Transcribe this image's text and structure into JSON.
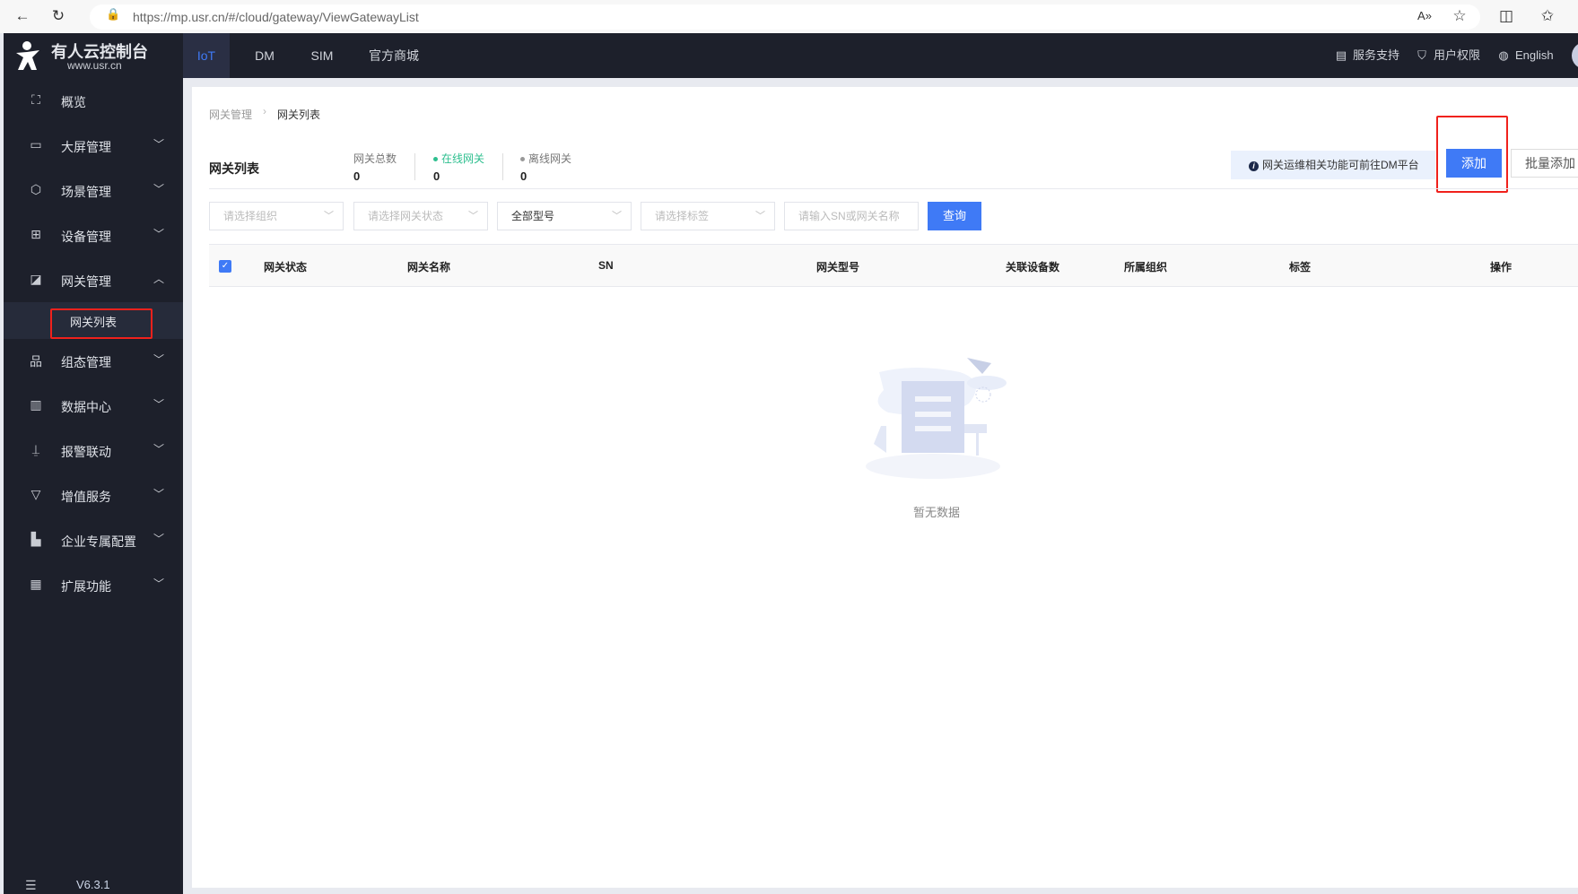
{
  "browser": {
    "url": "https://mp.usr.cn/#/cloud/gateway/ViewGatewayList"
  },
  "logo": {
    "title": "有人云控制台",
    "subtitle": "www.usr.cn"
  },
  "topnav": {
    "tabs": [
      {
        "label": "IoT",
        "active": true
      },
      {
        "label": "DM"
      },
      {
        "label": "SIM"
      },
      {
        "label": "官方商城"
      }
    ],
    "right": [
      {
        "label": "服务支持",
        "icon": "message-icon"
      },
      {
        "label": "用户权限",
        "icon": "shield-icon"
      },
      {
        "label": "English",
        "icon": "globe-icon"
      }
    ]
  },
  "sidebar": {
    "items": [
      {
        "label": "概览",
        "icon": "scan-icon"
      },
      {
        "label": "大屏管理",
        "icon": "monitor-icon"
      },
      {
        "label": "场景管理",
        "icon": "cube-icon"
      },
      {
        "label": "设备管理",
        "icon": "devices-icon"
      },
      {
        "label": "网关管理",
        "icon": "chart-icon",
        "expanded": true
      },
      {
        "label": "组态管理",
        "icon": "hierarchy-icon"
      },
      {
        "label": "数据中心",
        "icon": "bar-chart-icon"
      },
      {
        "label": "报警联动",
        "icon": "alarm-icon"
      },
      {
        "label": "增值服务",
        "icon": "diamond-icon"
      },
      {
        "label": "企业专属配置",
        "icon": "building-icon"
      },
      {
        "label": "扩展功能",
        "icon": "grid-icon"
      }
    ],
    "subitem": "网关列表",
    "version": "V6.3.1"
  },
  "breadcrumb": [
    "网关管理",
    "网关列表"
  ],
  "page": {
    "title": "网关列表",
    "stats": [
      {
        "label": "网关总数",
        "value": "0"
      },
      {
        "label": "在线网关",
        "value": "0",
        "color": "#2ebf8f"
      },
      {
        "label": "离线网关",
        "value": "0",
        "color": "#999999"
      }
    ],
    "info": "网关运维相关功能可前往DM平台",
    "add_label": "添加",
    "batch_add_label": "批量添加"
  },
  "filters": {
    "org_placeholder": "请选择组织",
    "status_placeholder": "请选择网关状态",
    "model_value": "全部型号",
    "tag_placeholder": "请选择标签",
    "search_placeholder": "请输入SN或网关名称",
    "query_label": "查询"
  },
  "table": {
    "columns": [
      "网关状态",
      "网关名称",
      "SN",
      "网关型号",
      "关联设备数",
      "所属组织",
      "标签",
      "操作"
    ],
    "empty_text": "暂无数据"
  },
  "colors": {
    "accent": "#3f7af6",
    "sidebar": "#1d202b",
    "highlight": "#f0211c"
  }
}
